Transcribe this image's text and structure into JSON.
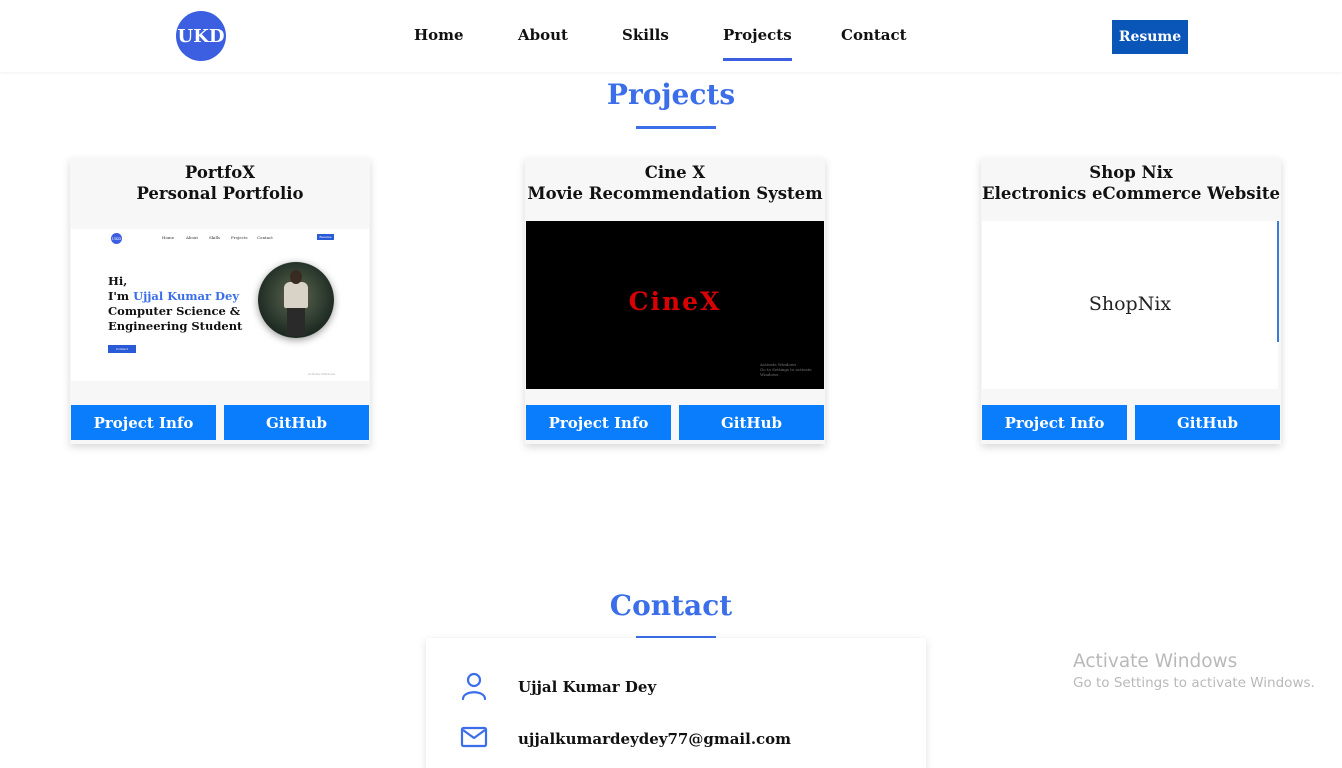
{
  "nav": {
    "logo": "UKD",
    "links": [
      "Home",
      "About",
      "Skills",
      "Projects",
      "Contact"
    ],
    "active": "Projects",
    "resume_label": "Resume"
  },
  "projects_section": {
    "title": "Projects",
    "cards": [
      {
        "name": "PortfoX",
        "subtitle": "Personal Portfolio",
        "info_label": "Project Info",
        "github_label": "GitHub",
        "preview": {
          "logo": "UKD",
          "nav": [
            "Home",
            "About",
            "Skills",
            "Projects",
            "Contact"
          ],
          "resume": "Resume",
          "greeting": "Hi,",
          "intro_prefix": "I'm ",
          "intro_name": "Ujjal Kumar Dey",
          "role_line1": "Computer Science &",
          "role_line2": "Engineering Student",
          "contact_btn": "Contact",
          "watermark": "Activate Windows"
        }
      },
      {
        "name": "Cine X",
        "subtitle": "Movie Recommendation System",
        "info_label": "Project Info",
        "github_label": "GitHub",
        "preview": {
          "logo_text": "CineX",
          "watermark_line1": "Activate Windows",
          "watermark_line2": "Go to Settings to activate Windows."
        }
      },
      {
        "name": "Shop Nix",
        "subtitle": "Electronics eCommerce Website",
        "info_label": "Project Info",
        "github_label": "GitHub",
        "preview": {
          "logo_text": "ShopNix"
        }
      }
    ]
  },
  "contact_section": {
    "title": "Contact",
    "name": "Ujjal Kumar Dey",
    "email": "ujjalkumardeydey77@gmail.com"
  },
  "watermark": {
    "title": "Activate Windows",
    "subtitle": "Go to Settings to activate Windows."
  },
  "colors": {
    "accent": "#3b6ee8",
    "button": "#0a7dfc",
    "resume": "#0a55b8",
    "cinex_red": "#d80000"
  },
  "icons": [
    "person-icon",
    "mail-icon"
  ]
}
